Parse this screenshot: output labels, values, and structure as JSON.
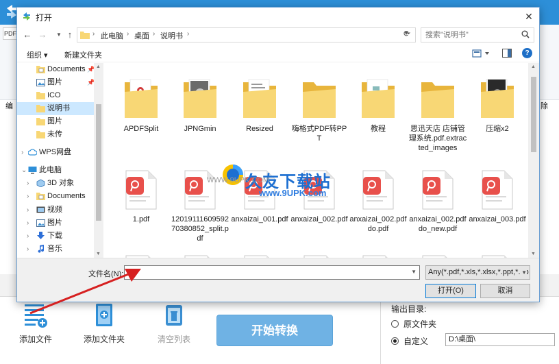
{
  "dialog": {
    "title": "打开",
    "close": "✕",
    "breadcrumb": [
      "此电脑",
      "桌面",
      "说明书"
    ],
    "search_placeholder": "搜索\"说明书\"",
    "toolbar": {
      "organize": "组织 ▾",
      "new_folder": "新建文件夹",
      "help": "?"
    },
    "nav": [
      {
        "label": "Documents",
        "icon": "documents-icon",
        "pinned": true
      },
      {
        "label": "图片",
        "icon": "pictures-icon",
        "pinned": true
      },
      {
        "label": "ICO",
        "icon": "folder-icon"
      },
      {
        "label": "说明书",
        "icon": "folder-icon",
        "selected": true
      },
      {
        "label": "图片",
        "icon": "folder-icon"
      },
      {
        "label": "未传",
        "icon": "folder-icon"
      },
      {
        "label": "WPS网盘",
        "icon": "cloud-icon"
      },
      {
        "label": "此电脑",
        "icon": "computer-icon"
      },
      {
        "label": "3D 对象",
        "icon": "3d-objects-icon"
      },
      {
        "label": "Documents",
        "icon": "documents-icon"
      },
      {
        "label": "视频",
        "icon": "video-icon"
      },
      {
        "label": "图片",
        "icon": "pictures-icon"
      },
      {
        "label": "下载",
        "icon": "download-icon"
      },
      {
        "label": "音乐",
        "icon": "music-icon"
      }
    ],
    "files": [
      {
        "name": "APDFSplit",
        "type": "folder"
      },
      {
        "name": "JPNGmin",
        "type": "folder"
      },
      {
        "name": "Resized",
        "type": "folder"
      },
      {
        "name": "嗨格式PDF转PPT",
        "type": "folder"
      },
      {
        "name": "教程",
        "type": "folder"
      },
      {
        "name": "思迅天店 店铺管理系统.pdf.extracted_images",
        "type": "folder"
      },
      {
        "name": "压缩x2",
        "type": "folder"
      },
      {
        "name": "1.pdf",
        "type": "pdf"
      },
      {
        "name": "1201911160959270380852_split.pdf",
        "type": "pdf"
      },
      {
        "name": "anxaizai_001.pdf",
        "type": "pdf"
      },
      {
        "name": "anxaizai_002.pdf",
        "type": "pdf"
      },
      {
        "name": "anxaizai_002.pdfdo.pdf",
        "type": "pdf"
      },
      {
        "name": "anxaizai_002.pdfdo_new.pdf",
        "type": "pdf"
      },
      {
        "name": "anxaizai_003.pdf",
        "type": "pdf"
      }
    ],
    "filename_label": "文件名(N):",
    "filename_value": "",
    "filetype": "Any(*.pdf,*.xls,*.xlsx,*.ppt,*.pp",
    "open_label": "打开(O)",
    "cancel_label": "取消"
  },
  "app": {
    "tab_label": "PDF",
    "left_label": "编",
    "right_label": "除",
    "add_file": "添加文件",
    "add_folder": "添加文件夹",
    "clear_list": "清空列表",
    "start": "开始转换",
    "output_title": "输出目录:",
    "radio_original": "原文件夹",
    "radio_custom": "自定义",
    "output_path": "D:\\桌面\\"
  },
  "watermark": {
    "title": "久友下载站",
    "url1": "WWW.9UPK.COM",
    "url2": "www.9UPK.com"
  },
  "colors": {
    "accent": "#2d8fd8",
    "folder": "#f8d775",
    "pdf_red": "#e8504b",
    "selected": "#cce8ff",
    "arrow": "#d62020"
  }
}
